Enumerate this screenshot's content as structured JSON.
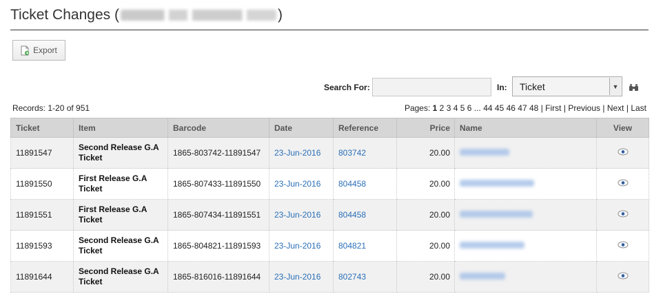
{
  "header": {
    "title_prefix": "Ticket Changes (",
    "title_suffix": ")",
    "event_name_redacted": true
  },
  "toolbar": {
    "export_label": "Export"
  },
  "search": {
    "label": "Search For:",
    "value": "",
    "in_label": "In:",
    "in_selected": "Ticket"
  },
  "records_text": "Records: 1-20 of 951",
  "pager": {
    "label": "Pages:",
    "current": "1",
    "pages": [
      "2",
      "3",
      "4",
      "5",
      "6",
      "...",
      "44",
      "45",
      "46",
      "47",
      "48"
    ],
    "first": "First",
    "previous": "Previous",
    "next": "Next",
    "last": "Last"
  },
  "table": {
    "columns": [
      "Ticket",
      "Item",
      "Barcode",
      "Date",
      "Reference",
      "Price",
      "Name",
      "View"
    ],
    "rows": [
      {
        "ticket": "11891547",
        "item": "Second Release G.A Ticket",
        "barcode": "1865-803742-11891547",
        "date": "23-Jun-2016",
        "reference": "803742",
        "price": "20.00"
      },
      {
        "ticket": "11891550",
        "item": "First Release G.A Ticket",
        "barcode": "1865-807433-11891550",
        "date": "23-Jun-2016",
        "reference": "804458",
        "price": "20.00"
      },
      {
        "ticket": "11891551",
        "item": "First Release G.A Ticket",
        "barcode": "1865-807434-11891551",
        "date": "23-Jun-2016",
        "reference": "804458",
        "price": "20.00"
      },
      {
        "ticket": "11891593",
        "item": "Second Release G.A Ticket",
        "barcode": "1865-804821-11891593",
        "date": "23-Jun-2016",
        "reference": "804821",
        "price": "20.00"
      },
      {
        "ticket": "11891644",
        "item": "Second Release G.A Ticket",
        "barcode": "1865-816016-11891644",
        "date": "23-Jun-2016",
        "reference": "802743",
        "price": "20.00"
      }
    ]
  },
  "colors": {
    "link": "#2a6fb7",
    "header_bg": "#d6d6d6",
    "row_alt": "#f1f1f1"
  },
  "icons": {
    "export": "document-export-icon",
    "search": "binoculars-icon",
    "view": "eye-icon",
    "dropdown": "chevron-down-icon"
  }
}
